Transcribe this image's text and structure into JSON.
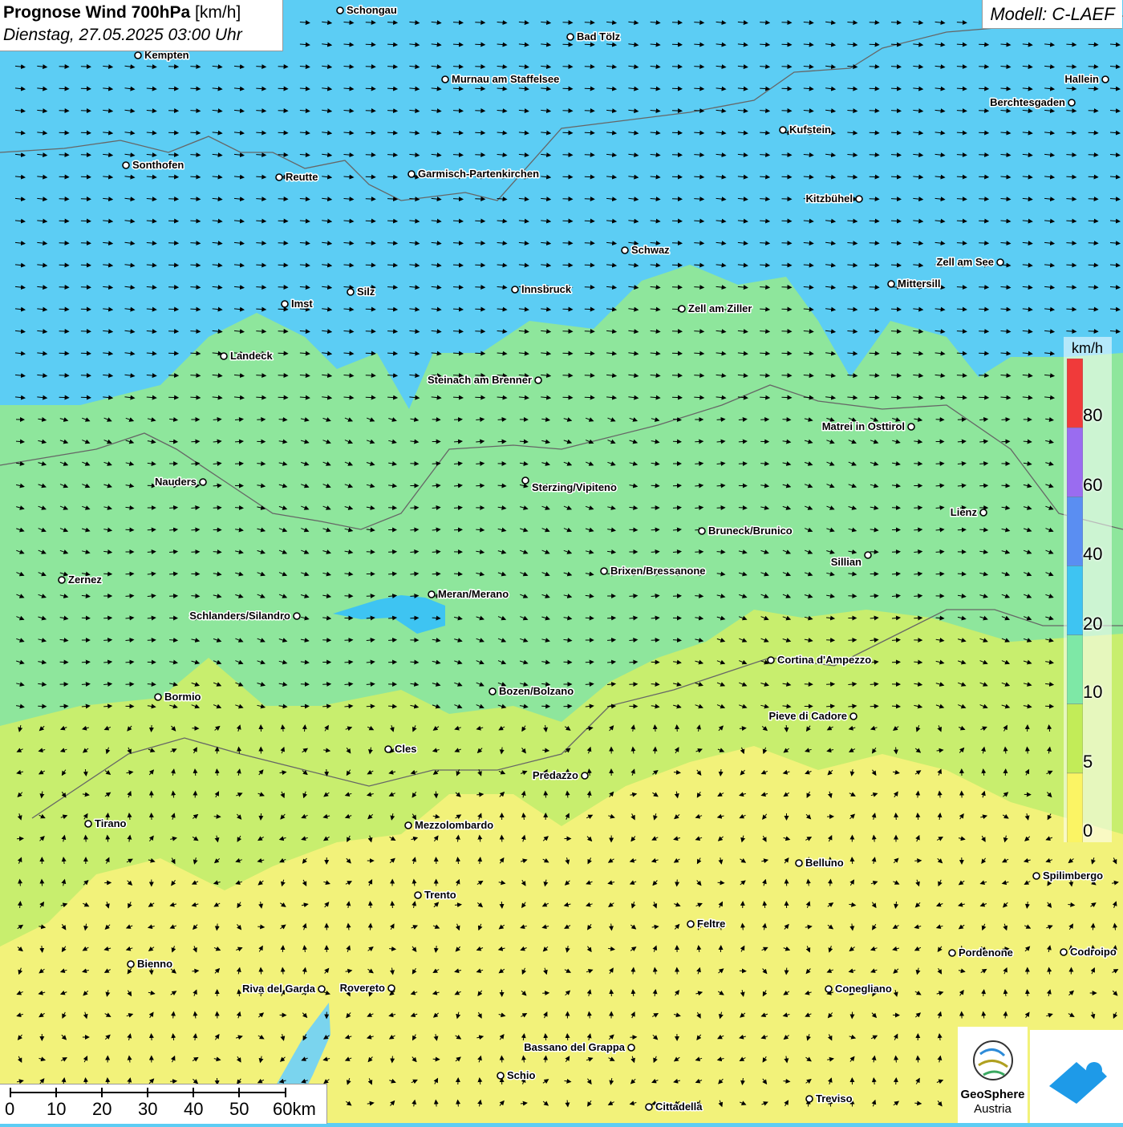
{
  "title": {
    "main": "Prognose Wind 700hPa",
    "unit": "[km/h]",
    "datetime": "Dienstag, 27.05.2025 03:00 Uhr"
  },
  "model": "Modell: C-LAEF",
  "legend": {
    "unit": "km/h",
    "ticks": [
      "80",
      "60",
      "40",
      "20",
      "10",
      "5",
      "0"
    ],
    "colors": [
      "#f03a3a",
      "#9a6cf0",
      "#5a8ef2",
      "#3ec4f2",
      "#7ee8a6",
      "#c2ec58",
      "#fbf464"
    ]
  },
  "scale_bar": {
    "ticks": [
      "0",
      "10",
      "20",
      "30",
      "40",
      "50",
      "60km"
    ]
  },
  "logo": {
    "name": "GeoSphere",
    "sub": "Austria"
  },
  "colors": {
    "band_20": "#5ccdf4",
    "band_10": "#8ee69c",
    "band_5": "#c8ee6e",
    "band_0": "#f2f27a"
  },
  "cities": [
    {
      "name": "Schongau"
    },
    {
      "name": "Bad Tölz"
    },
    {
      "name": "Kempten"
    },
    {
      "name": "Murnau am Staffelsee"
    },
    {
      "name": "Hallein"
    },
    {
      "name": "Berchtesgaden"
    },
    {
      "name": "Kufstein"
    },
    {
      "name": "Sonthofen"
    },
    {
      "name": "Reutte"
    },
    {
      "name": "Garmisch-Partenkirchen"
    },
    {
      "name": "Kitzbühel"
    },
    {
      "name": "Schwaz"
    },
    {
      "name": "Zell am See"
    },
    {
      "name": "Mittersill"
    },
    {
      "name": "Silz"
    },
    {
      "name": "Innsbruck"
    },
    {
      "name": "Imst"
    },
    {
      "name": "Zell am Ziller"
    },
    {
      "name": "Landeck"
    },
    {
      "name": "Steinach am Brenner"
    },
    {
      "name": "Matrei in Osttirol"
    },
    {
      "name": "Nauders"
    },
    {
      "name": "Sterzing/Vipiteno"
    },
    {
      "name": "Lienz"
    },
    {
      "name": "Bruneck/Brunico"
    },
    {
      "name": "Sillian"
    },
    {
      "name": "Zernez"
    },
    {
      "name": "Brixen/Bressanone"
    },
    {
      "name": "Meran/Merano"
    },
    {
      "name": "Schlanders/Silandro"
    },
    {
      "name": "Cortina d'Ampezzo"
    },
    {
      "name": "Bozen/Bolzano"
    },
    {
      "name": "Bormio"
    },
    {
      "name": "Pieve di Cadore"
    },
    {
      "name": "Cles"
    },
    {
      "name": "Predazzo"
    },
    {
      "name": "Tirano"
    },
    {
      "name": "Mezzolombardo"
    },
    {
      "name": "Belluno"
    },
    {
      "name": "Spilimbergo"
    },
    {
      "name": "Trento"
    },
    {
      "name": "Feltre"
    },
    {
      "name": "Pordenone"
    },
    {
      "name": "Codroipo"
    },
    {
      "name": "Bienno"
    },
    {
      "name": "Riva del Garda"
    },
    {
      "name": "Rovereto"
    },
    {
      "name": "Conegliano"
    },
    {
      "name": "Bassano del Grappa"
    },
    {
      "name": "Schio"
    },
    {
      "name": "Treviso"
    },
    {
      "name": "Cittadella"
    }
  ]
}
